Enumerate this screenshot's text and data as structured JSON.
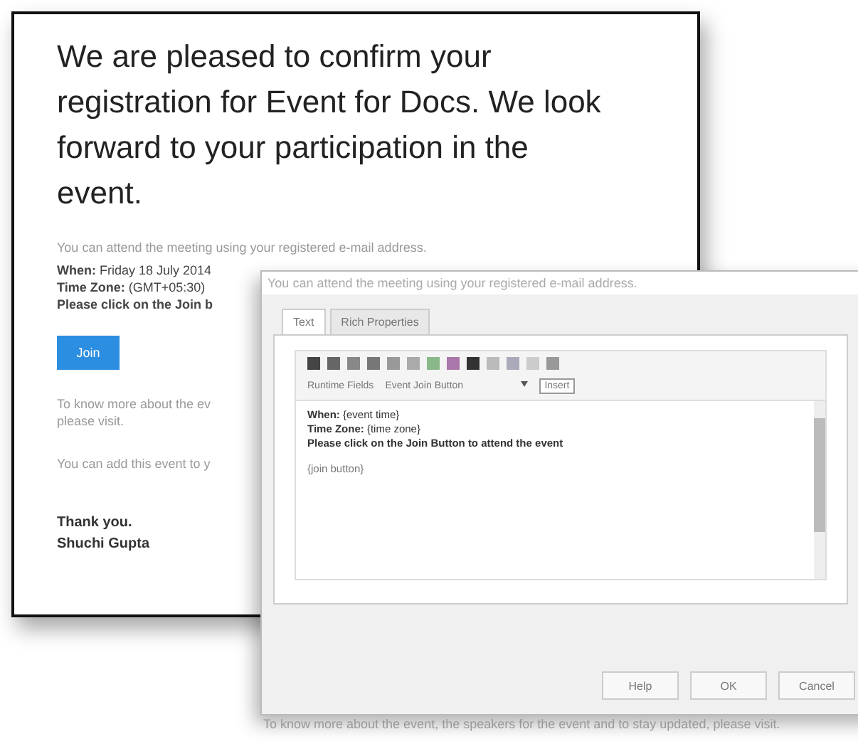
{
  "email": {
    "heading": "We are pleased to confirm your registration for Event for Docs. We look forward to your participation in the event.",
    "intro": "You can attend the meeting using your registered e-mail address.",
    "details": [
      {
        "label": "When:",
        "value": " Friday 18 July 2014"
      },
      {
        "label": "Time Zone:",
        "value": " (GMT+05:30)"
      },
      {
        "label": "Please click on the Join b"
      }
    ],
    "join_button": "Join",
    "more_info": [
      "To know more about the ev",
      "please visit."
    ],
    "add_event": "You can add this event to y",
    "signoff": [
      "Thank you.",
      "Shuchi Gupta"
    ]
  },
  "dialog": {
    "header": "You can attend the meeting using your registered e-mail address.",
    "tabs": [
      {
        "label": "Text",
        "selected": true
      },
      {
        "label": "Rich Properties",
        "selected": false
      }
    ],
    "runtime_label": "Runtime Fields",
    "runtime_select": "Event Join Button",
    "insert_button": "Insert",
    "content": [
      {
        "label": "When:",
        "value": " {event time}"
      },
      {
        "label": "Time Zone:",
        "value": " {time zone}"
      },
      {
        "label": "Please click on the Join Button to attend the event"
      }
    ],
    "placeholder_field": "{join button}",
    "buttons": [
      "Help",
      "OK",
      "Cancel"
    ]
  },
  "footer_text": "To know more about the event, the speakers for the event and to stay updated, please visit."
}
